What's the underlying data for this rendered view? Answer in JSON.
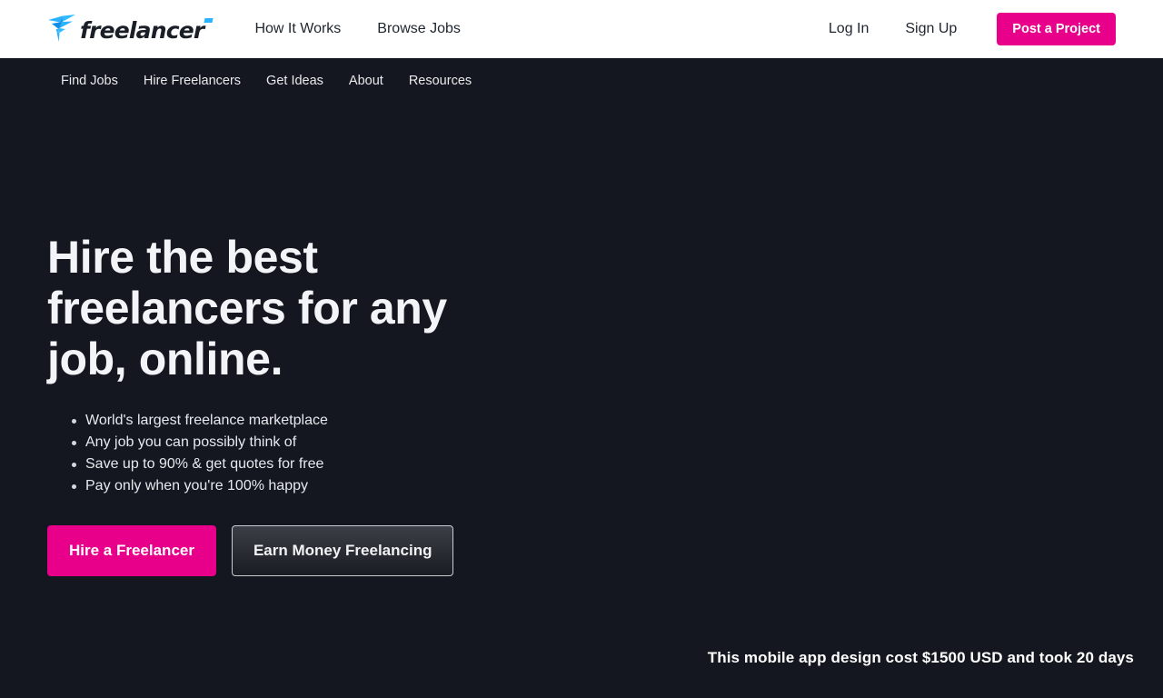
{
  "header": {
    "logo": {
      "name": "freelancer",
      "icon": "freelancer-bird-logo",
      "bird_color_light": "#29b2fe",
      "bird_color_dark": "#0f8ee8"
    },
    "nav": [
      {
        "label": "How It Works"
      },
      {
        "label": "Browse Jobs"
      }
    ],
    "auth": [
      {
        "label": "Log In"
      },
      {
        "label": "Sign Up"
      }
    ],
    "post_project_label": "Post a Project",
    "accent_color": "#e8008a",
    "background": "#ffffff"
  },
  "sub_nav": {
    "items": [
      {
        "label": "Find Jobs"
      },
      {
        "label": "Hire Freelancers"
      },
      {
        "label": "Get Ideas"
      },
      {
        "label": "About"
      },
      {
        "label": "Resources"
      }
    ],
    "background": "#14171F"
  },
  "hero": {
    "title": "Hire the best freelancers for any job, online.",
    "bullets": [
      "World's largest freelance marketplace",
      "Any job you can possibly think of",
      "Save up to 90% & get quotes for free",
      "Pay only when you're 100% happy"
    ],
    "primary_cta": "Hire a Freelancer",
    "secondary_cta": "Earn Money Freelancing",
    "caption": "This mobile app design cost $1500 USD and took 20 days",
    "background": "#14171F",
    "text_color": "#f2f4f7"
  }
}
